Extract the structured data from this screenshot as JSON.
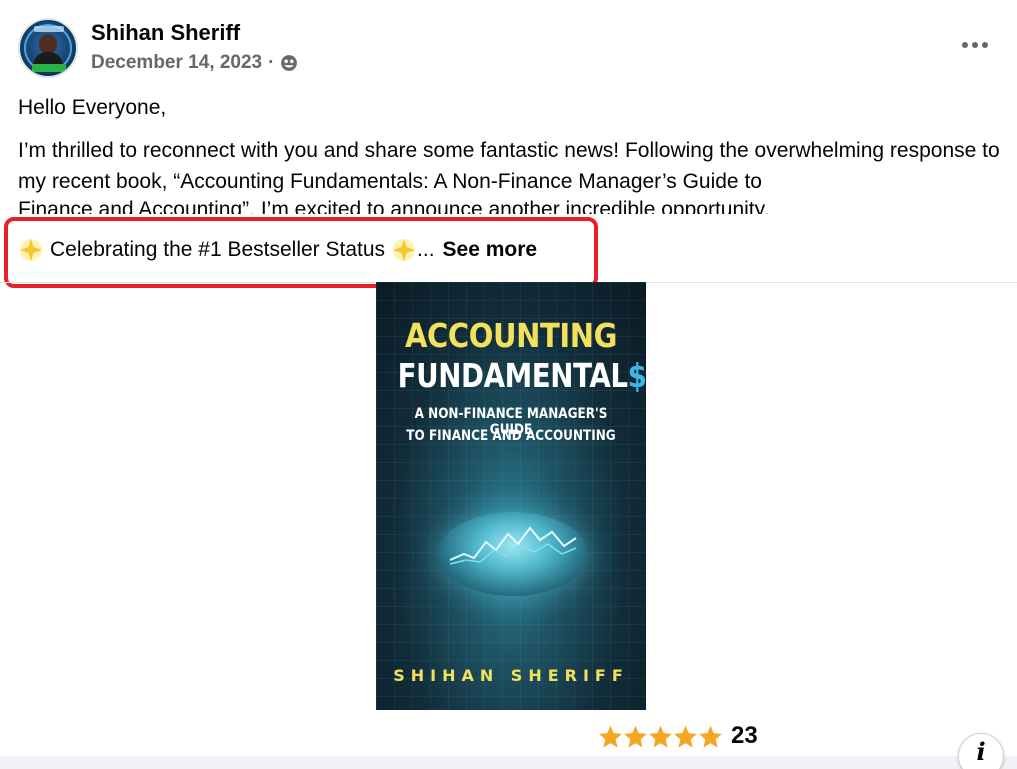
{
  "post": {
    "author": "Shihan Sheriff",
    "date": "December 14, 2023",
    "separator": "·",
    "audience_icon": "globe-icon",
    "more_icon": "more-options-icon"
  },
  "content": {
    "greeting": "Hello Everyone,",
    "paragraph": "I’m thrilled to reconnect with you and share some fantastic news! Following the overwhelming response to my recent book, “Accounting Fundamentals: A Non-Finance Manager’s Guide to",
    "clipped_line": "Finance and Accounting”, I’m excited to announce another incredible opportunity.",
    "celebrate_text": "Celebrating the #1 Bestseller Status",
    "ellipsis": "...",
    "see_more": "See more",
    "sparkle_icon": "glowing-star-icon",
    "highlight_color": "#e8202a"
  },
  "book": {
    "title_line_1": "ACCOUNTING",
    "title_line_2": "FUNDAMENTAL",
    "title_dollar": "$",
    "subtitle_line_1": "A NON-FINANCE MANAGER'S GUIDE",
    "subtitle_line_2": "TO FINANCE AND ACCOUNTING",
    "author": "SHIHAN SHERIFF"
  },
  "rating": {
    "stars": 5,
    "count": "23",
    "star_color": "#f5a623"
  },
  "info_button": {
    "label": "i"
  }
}
